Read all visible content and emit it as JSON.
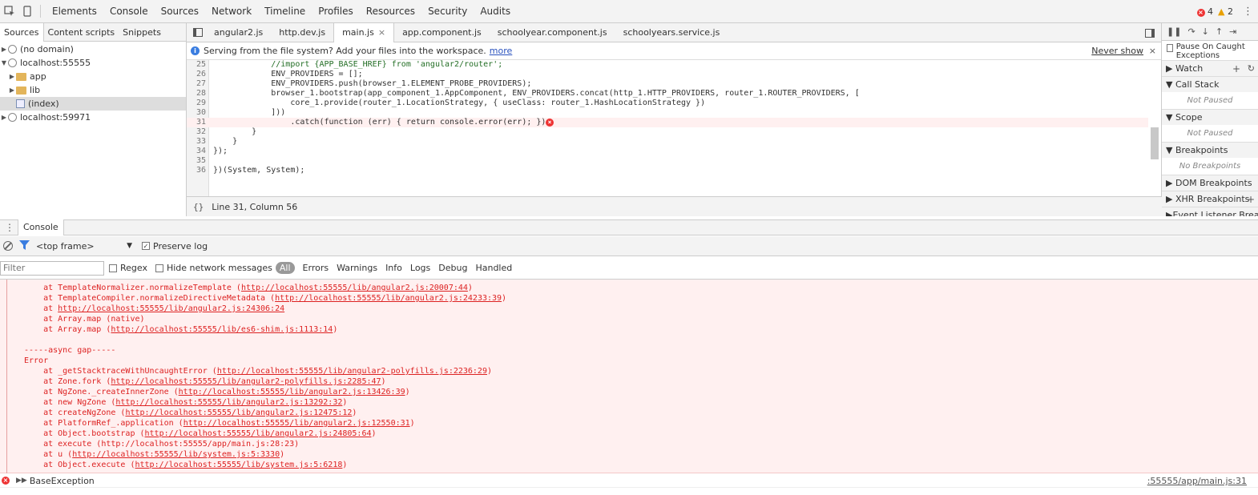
{
  "toolbar": {
    "tabs": [
      "Elements",
      "Console",
      "Sources",
      "Network",
      "Timeline",
      "Profiles",
      "Resources",
      "Security",
      "Audits"
    ],
    "error_count": "4",
    "warning_count": "2"
  },
  "navigator": {
    "tabs": [
      "Sources",
      "Content scripts",
      "Snippets"
    ],
    "tree": [
      "(no domain)",
      "localhost:55555",
      "app",
      "lib",
      "(index)",
      "localhost:59971"
    ]
  },
  "editor": {
    "file_tabs": [
      "angular2.js",
      "http.dev.js",
      "main.js",
      "app.component.js",
      "schoolyear.component.js",
      "schoolyears.service.js"
    ],
    "infobar_text": "Serving from the file system? Add your files into the workspace.",
    "infobar_link": "more",
    "infobar_dismiss": "Never show",
    "status": "Line 31, Column 56",
    "lines": [
      {
        "n": "25",
        "t": "            //import {APP_BASE_HREF} from 'angular2/router';"
      },
      {
        "n": "26",
        "t": "            ENV_PROVIDERS = [];"
      },
      {
        "n": "27",
        "t": "            ENV_PROVIDERS.push(browser_1.ELEMENT_PROBE_PROVIDERS);"
      },
      {
        "n": "28",
        "t": "            browser_1.bootstrap(app_component_1.AppComponent, ENV_PROVIDERS.concat(http_1.HTTP_PROVIDERS, router_1.ROUTER_PROVIDERS, ["
      },
      {
        "n": "29",
        "t": "                core_1.provide(router_1.LocationStrategy, { useClass: router_1.HashLocationStrategy })"
      },
      {
        "n": "30",
        "t": "            ]))"
      },
      {
        "n": "31",
        "t": "                .catch(function (err) { return console.error(err); });"
      },
      {
        "n": "32",
        "t": "        }"
      },
      {
        "n": "33",
        "t": "    }"
      },
      {
        "n": "34",
        "t": "});"
      },
      {
        "n": "35",
        "t": ""
      },
      {
        "n": "36",
        "t": "})(System, System);"
      }
    ]
  },
  "debugger": {
    "pause_label": "Pause On Caught Exceptions",
    "sections": [
      {
        "title": "Watch",
        "body": ""
      },
      {
        "title": "Call Stack",
        "body": "Not Paused"
      },
      {
        "title": "Scope",
        "body": "Not Paused"
      },
      {
        "title": "Breakpoints",
        "body": "No Breakpoints"
      },
      {
        "title": "DOM Breakpoints",
        "body": ""
      },
      {
        "title": "XHR Breakpoints",
        "body": ""
      },
      {
        "title": "Event Listener Breakpoints",
        "body": ""
      }
    ]
  },
  "drawer": {
    "tab": "Console"
  },
  "console": {
    "frame": "<top frame>",
    "preserve_log": "Preserve log",
    "filter_placeholder": "Filter",
    "regex": "Regex",
    "hide_network": "Hide network messages",
    "levels": [
      "All",
      "Errors",
      "Warnings",
      "Info",
      "Logs",
      "Debug",
      "Handled"
    ],
    "lines": [
      {
        "pre": "    at TemplateNormalizer.normalizeTemplate (",
        "link": "http://localhost:55555/lib/angular2.js:20007:44",
        "post": ")"
      },
      {
        "pre": "    at TemplateCompiler.normalizeDirectiveMetadata (",
        "link": "http://localhost:55555/lib/angular2.js:24233:39",
        "post": ")"
      },
      {
        "pre": "    at ",
        "link": "http://localhost:55555/lib/angular2.js:24306:24",
        "post": ""
      },
      {
        "pre": "    at Array.map (native)",
        "link": "",
        "post": ""
      },
      {
        "pre": "    at Array.map (",
        "link": "http://localhost:55555/lib/es6-shim.js:1113:14",
        "post": ")"
      },
      {
        "pre": "",
        "link": "",
        "post": ""
      },
      {
        "pre": "-----async gap-----",
        "link": "",
        "post": ""
      },
      {
        "pre": "Error",
        "link": "",
        "post": ""
      },
      {
        "pre": "    at _getStacktraceWithUncaughtError (",
        "link": "http://localhost:55555/lib/angular2-polyfills.js:2236:29",
        "post": ")"
      },
      {
        "pre": "    at Zone.fork (",
        "link": "http://localhost:55555/lib/angular2-polyfills.js:2285:47",
        "post": ")"
      },
      {
        "pre": "    at NgZone._createInnerZone (",
        "link": "http://localhost:55555/lib/angular2.js:13426:39",
        "post": ")"
      },
      {
        "pre": "    at new NgZone (",
        "link": "http://localhost:55555/lib/angular2.js:13292:32",
        "post": ")"
      },
      {
        "pre": "    at createNgZone (",
        "link": "http://localhost:55555/lib/angular2.js:12475:12",
        "post": ")"
      },
      {
        "pre": "    at PlatformRef_.application (",
        "link": "http://localhost:55555/lib/angular2.js:12550:31",
        "post": ")"
      },
      {
        "pre": "    at Object.bootstrap (",
        "link": "http://localhost:55555/lib/angular2.js:24805:64",
        "post": ")"
      },
      {
        "pre": "    at execute (http://localhost:55555/app/main.js:28:23)",
        "link": "",
        "post": ""
      },
      {
        "pre": "    at u (",
        "link": "http://localhost:55555/lib/system.js:5:3330",
        "post": ")"
      },
      {
        "pre": "    at Object.execute (",
        "link": "http://localhost:55555/lib/system.js:5:6218",
        "post": ")"
      }
    ],
    "base_exception": "BaseException",
    "base_exception_source": ":55555/app/main.js:31"
  }
}
